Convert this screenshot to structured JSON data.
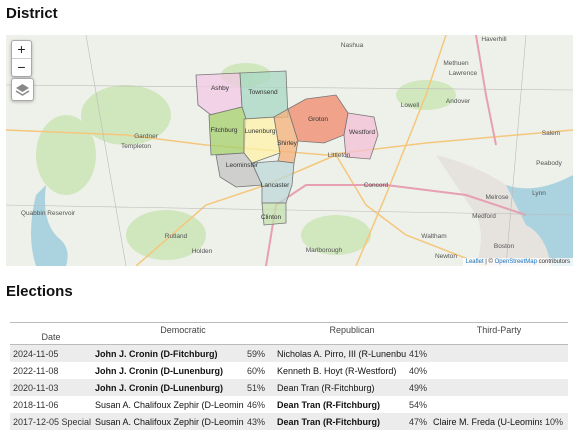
{
  "sections": {
    "district": "District",
    "elections": "Elections"
  },
  "map": {
    "zoom_in": "+",
    "zoom_out": "−",
    "attribution": {
      "leaflet": "Leaflet",
      "sep": " | © ",
      "osm": "OpenStreetMap",
      "rest": " contributors"
    },
    "towns": [
      "Ashby",
      "Townsend",
      "Groton",
      "Westford",
      "Fitchburg",
      "Lunenburg",
      "Shirley",
      "Leominster",
      "Lancaster",
      "Clinton"
    ],
    "places": [
      "Nashua",
      "Haverhill",
      "Methuen",
      "Lawrence",
      "Lowell",
      "Andover",
      "Salem",
      "Peabody",
      "Lynn",
      "Medford",
      "Melrose",
      "Boston",
      "Newton",
      "Waltham",
      "Marlborough",
      "Gardner",
      "Templeton",
      "Littleton",
      "Concord",
      "Quabbin Reservoir",
      "Rutland",
      "Holden"
    ],
    "colors": {
      "Ashby": "#f3c8e4",
      "Townsend": "#a8d8c4",
      "Groton": "#f08a6a",
      "Westford": "#f4c0d6",
      "Fitchburg": "#a6d06c",
      "Lunenburg": "#fdf3a8",
      "Shirley": "#f6b27a",
      "Leominster": "#c4c4c4",
      "Lancaster": "#bcd8d8",
      "Clinton": "#c4e2ae"
    }
  },
  "elections": {
    "headers": {
      "date": "Date",
      "dem": "Democratic",
      "rep": "Republican",
      "third": "Third-Party"
    },
    "rows": [
      {
        "date": "2024-11-05",
        "dem": "John J. Cronin (D-Fitchburg)",
        "dem_pct": "59%",
        "dem_win": true,
        "rep": "Nicholas A. Pirro, III (R-Lunenburg)",
        "rep_pct": "41%",
        "rep_win": false,
        "third": "",
        "third_pct": ""
      },
      {
        "date": "2022-11-08",
        "dem": "John J. Cronin (D-Lunenburg)",
        "dem_pct": "60%",
        "dem_win": true,
        "rep": "Kenneth B. Hoyt (R-Westford)",
        "rep_pct": "40%",
        "rep_win": false,
        "third": "",
        "third_pct": ""
      },
      {
        "date": "2020-11-03",
        "dem": "John J. Cronin (D-Lunenburg)",
        "dem_pct": "51%",
        "dem_win": true,
        "rep": "Dean Tran (R-Fitchburg)",
        "rep_pct": "49%",
        "rep_win": false,
        "third": "",
        "third_pct": ""
      },
      {
        "date": "2018-11-06",
        "dem": "Susan A. Chalifoux Zephir (D-Leominster)",
        "dem_pct": "46%",
        "dem_win": false,
        "rep": "Dean Tran (R-Fitchburg)",
        "rep_pct": "54%",
        "rep_win": true,
        "third": "",
        "third_pct": ""
      },
      {
        "date": "2017-12-05 Special",
        "dem": "Susan A. Chalifoux Zephir (D-Leominster)",
        "dem_pct": "43%",
        "dem_win": false,
        "rep": "Dean Tran (R-Fitchburg)",
        "rep_pct": "47%",
        "rep_win": true,
        "third": "Claire M. Freda (U-Leominster)",
        "third_pct": "10%"
      }
    ]
  }
}
